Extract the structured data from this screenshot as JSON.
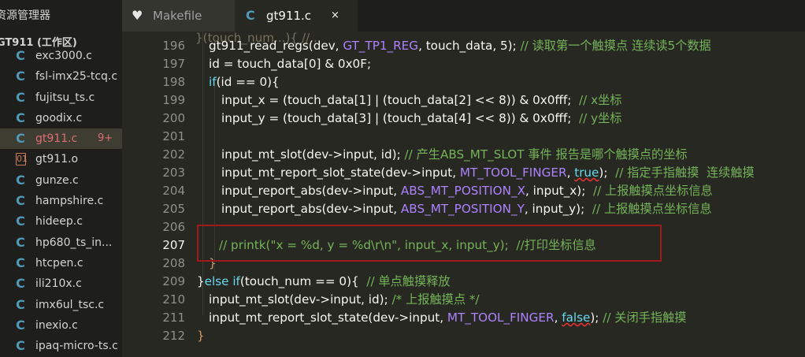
{
  "sidebar": {
    "title": "资源管理器",
    "section": "GT911 (工作区)",
    "files": [
      {
        "name": "exc3000.c",
        "icon": "c-file-icon"
      },
      {
        "name": "fsl-imx25-tcq.c",
        "icon": "c-file-icon"
      },
      {
        "name": "fujitsu_ts.c",
        "icon": "c-file-icon"
      },
      {
        "name": "goodix.c",
        "icon": "c-file-icon"
      },
      {
        "name": "gt911.c",
        "icon": "c-file-icon",
        "badge": "9+",
        "active": true
      },
      {
        "name": "gt911.o",
        "icon": "object-file-icon"
      },
      {
        "name": "gunze.c",
        "icon": "c-file-icon"
      },
      {
        "name": "hampshire.c",
        "icon": "c-file-icon"
      },
      {
        "name": "hideep.c",
        "icon": "c-file-icon"
      },
      {
        "name": "hp680_ts_in...",
        "icon": "c-file-icon"
      },
      {
        "name": "htcpen.c",
        "icon": "c-file-icon"
      },
      {
        "name": "ili210x.c",
        "icon": "c-file-icon"
      },
      {
        "name": "imx6ul_tsc.c",
        "icon": "c-file-icon"
      },
      {
        "name": "inexio.c",
        "icon": "c-file-icon"
      },
      {
        "name": "ipaq-micro-ts.c",
        "icon": "c-file-icon"
      }
    ]
  },
  "tabs": [
    {
      "label": "Makefile",
      "icon": "makefile-icon",
      "active": false
    },
    {
      "label": "gt911.c",
      "icon": "c-file-icon",
      "active": true,
      "close": "×"
    }
  ],
  "editor": {
    "line_numbers": [
      "196",
      "197",
      "198",
      "199",
      "200",
      "201",
      "202",
      "203",
      "204",
      "205",
      "206",
      "207",
      "208",
      "209",
      "210",
      "211",
      "212"
    ],
    "current_line": "207",
    "lines": {
      "l196_code": "gt911_read_regs(dev, ",
      "l196_macro": "GT_TP1_REG",
      "l196_rest": ", touch_data, 5);",
      "l196_comment": "// 读取第一个触摸点 连续读5个数据",
      "l197": "id = touch_data[0] & 0x0F;",
      "l198_kw": "if",
      "l198_rest": "(id == 0){",
      "l199_a": "input_x = ",
      "l199_b": "(touch_data[1] | ",
      "l199_c": "(touch_data[2] << 8",
      "l199_d": ")) & 0x0fff;",
      "l199_comment": "// x坐标",
      "l200_a": "input_y = ",
      "l200_b": "(touch_data[3] | ",
      "l200_c": "(touch_data[4] << 8",
      "l200_d": ")) & 0x0fff;",
      "l200_comment": "// y坐标",
      "l202_code": "input_mt_slot(dev->input, id);",
      "l202_comment": "// 产生ABS_MT_SLOT 事件 报告是哪个触摸点的坐标",
      "l203_code": "input_mt_report_slot_state(dev->input, ",
      "l203_macro": "MT_TOOL_FINGER",
      "l203_sep": ", ",
      "l203_kw": "true",
      "l203_end": ");",
      "l203_comment": "// 指定手指触摸  连续触摸",
      "l204_code": "input_report_abs(dev->input, ",
      "l204_macro": "ABS_MT_POSITION_X",
      "l204_end": ", input_x);",
      "l204_comment": "// 上报触摸点坐标信息",
      "l205_code": "input_report_abs(dev->input, ",
      "l205_macro": "ABS_MT_POSITION_Y",
      "l205_end": ", input_y);",
      "l205_comment": "// 上报触摸点坐标信息",
      "l207_comment": "// printk(\"x = %d, y = %d\\r\\n\", input_x, input_y);  //打印坐标信息",
      "l208": "}",
      "l209_brace": "}",
      "l209_kw": "else if",
      "l209_rest": "(touch_num == 0){",
      "l209_comment": "// 单点触摸释放",
      "l210_code": "input_mt_slot(dev->input, id);",
      "l210_comment": "/* 上报触摸点 */",
      "l211_code": "input_mt_report_slot_state(dev->input, ",
      "l211_macro": "MT_TOOL_FINGER",
      "l211_sep": ", ",
      "l211_kw": "false",
      "l211_end": ");",
      "l211_comment": "// 关闭手指触摸",
      "l212": "}"
    }
  },
  "colors": {
    "accent_c_icon": "#519aba",
    "highlight_box": "#9e1b1b",
    "active_file": "#e06c75"
  }
}
